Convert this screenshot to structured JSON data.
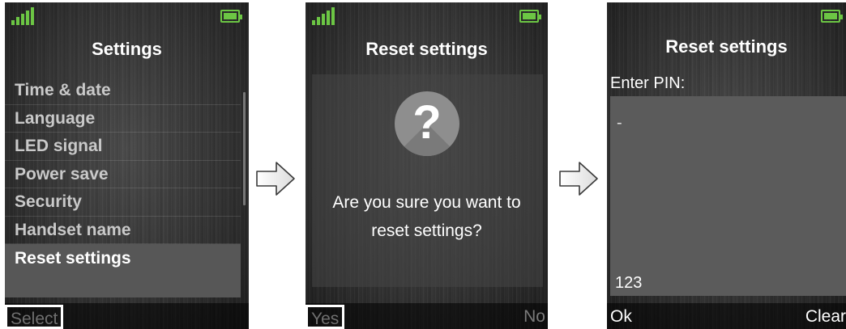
{
  "screens": {
    "settings": {
      "title": "Settings",
      "menu": [
        "Time & date",
        "Language",
        "LED signal",
        "Power save",
        "Security",
        "Handset name",
        "Reset settings"
      ],
      "softkey_left": "Select"
    },
    "confirm": {
      "title": "Reset settings",
      "icon": "question-icon",
      "icon_glyph": "?",
      "question_line1": "Are you sure you want to",
      "question_line2": "reset settings?",
      "softkey_left": "Yes",
      "softkey_right": "No"
    },
    "pin": {
      "title": "Reset settings",
      "label": "Enter PIN:",
      "cursor": "-",
      "input_mode": "123",
      "softkey_left": "Ok",
      "softkey_right": "Clear"
    }
  },
  "colors": {
    "signal": "#6cc644",
    "battery": "#6cc644",
    "highlight": "#575757"
  },
  "icons": {
    "flow_arrow": "arrow-right-icon",
    "signal": "signal-icon",
    "battery": "battery-icon"
  }
}
